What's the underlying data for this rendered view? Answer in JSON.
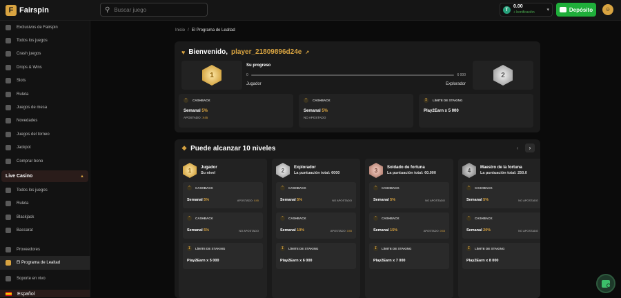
{
  "brand": {
    "name": "Fairspin"
  },
  "search": {
    "placeholder": "Buscar juego"
  },
  "wallet": {
    "amount": "0.00",
    "bonus_label": "+ bonificación",
    "currency_icon": "tether-icon"
  },
  "deposit": {
    "label": "Depósito"
  },
  "sidebar": {
    "items_top": [
      {
        "label": "Exclusivos de Fairspin",
        "icon": "diamond-icon"
      },
      {
        "label": "Todos los juegos",
        "icon": "grid-icon"
      },
      {
        "label": "Crash juegos",
        "icon": "rocket-icon"
      },
      {
        "label": "Drops & Wins",
        "icon": "drop-icon"
      },
      {
        "label": "Slots",
        "icon": "slot-icon"
      },
      {
        "label": "Ruleta",
        "icon": "roulette-icon"
      },
      {
        "label": "Juegos de mesa",
        "icon": "cards-icon"
      },
      {
        "label": "Novedades",
        "icon": "new-icon"
      },
      {
        "label": "Juegos del torneo",
        "icon": "trophy-icon"
      },
      {
        "label": "Jackpot",
        "icon": "jackpot-icon"
      },
      {
        "label": "Comprar bono",
        "icon": "cart-icon"
      }
    ],
    "live_casino_label": "Live Casino",
    "items_live": [
      {
        "label": "Todos los juegos",
        "icon": "grid-icon"
      },
      {
        "label": "Ruleta",
        "icon": "roulette-icon"
      },
      {
        "label": "Blackjack",
        "icon": "blackjack-icon"
      },
      {
        "label": "Baccarat",
        "icon": "baccarat-icon"
      }
    ],
    "items_bottom": [
      {
        "label": "Proveedores",
        "icon": "gamepad-icon"
      },
      {
        "label": "El Programa de Lealtad",
        "icon": "medal-icon"
      },
      {
        "label": "Soporte en vivo",
        "icon": "support-icon"
      }
    ],
    "language": "Español"
  },
  "breadcrumb": {
    "home": "Inicio",
    "separator": "/",
    "current": "El Programa de Lealtad"
  },
  "welcome": {
    "prefix": "Bienvenido,",
    "username": "player_21809896d24e",
    "progress_title": "Su progreso",
    "progress_min": "0",
    "progress_max": "6 000",
    "progress_fraction": 0,
    "current_level": "Jugador",
    "next_level": "Explorador",
    "current_medal": "1",
    "next_medal": "2",
    "benefits": [
      {
        "title": "CASHBACK",
        "line1_label": "Semanal",
        "line1_pct": "5%",
        "line2_label": "APOSTADO:",
        "line2_value": "X45"
      },
      {
        "title": "CASHBACK",
        "line1_label": "Semanal",
        "line1_pct": "5%",
        "line2_label": "NO APOSTADO",
        "line2_value": ""
      },
      {
        "title": "LÍMITE DE STAKING",
        "line1_label": "Play2Earn x 5 000",
        "line1_pct": "",
        "line2_label": "",
        "line2_value": ""
      }
    ]
  },
  "levels": {
    "title": "Puede alcanzar 10 niveles",
    "columns": [
      {
        "medal": "1",
        "name": "Jugador",
        "sub": "Su nivel",
        "cb1": {
          "title": "CASHBACK",
          "label": "Semanal",
          "pct": "5%",
          "note_label": "APOSTADO:",
          "note_value": "X45"
        },
        "cb2": {
          "title": "CASHBACK",
          "label": "Semanal",
          "pct": "5%",
          "note_label": "NO APOSTADO",
          "note_value": ""
        },
        "stake": {
          "title": "LÍMITE DE STAKING",
          "label": "Play2Earn x 5 000"
        }
      },
      {
        "medal": "2",
        "name": "Explorador",
        "sub": "La puntuación total:  6000",
        "cb1": {
          "title": "CASHBACK",
          "label": "Semanal",
          "pct": "5%",
          "note_label": "NO APOSTADO",
          "note_value": ""
        },
        "cb2": {
          "title": "CASHBACK",
          "label": "Semanal",
          "pct": "10%",
          "note_label": "APOSTADO:",
          "note_value": "X45"
        },
        "stake": {
          "title": "LÍMITE DE STAKING",
          "label": "Play2Earn x 6 000"
        }
      },
      {
        "medal": "3",
        "name": "Soldado de fortuna",
        "sub": "La puntuación total:  60.000",
        "cb1": {
          "title": "CASHBACK",
          "label": "Semanal",
          "pct": "5%",
          "note_label": "NO APOSTADO",
          "note_value": ""
        },
        "cb2": {
          "title": "CASHBACK",
          "label": "Semanal",
          "pct": "15%",
          "note_label": "APOSTADO:",
          "note_value": "X45"
        },
        "stake": {
          "title": "LÍMITE DE STAKING",
          "label": "Play2Earn x 7 000"
        }
      },
      {
        "medal": "4",
        "name": "Maestro de la fortuna",
        "sub": "La puntuación total:  250.0",
        "cb1": {
          "title": "CASHBACK",
          "label": "Semanal",
          "pct": "5%",
          "note_label": "NO APOSTADO",
          "note_value": ""
        },
        "cb2": {
          "title": "CASHBACK",
          "label": "Semanal",
          "pct": "20%",
          "note_label": "NO APOSTADO",
          "note_value": ""
        },
        "stake": {
          "title": "LÍMITE DE STAKING",
          "label": "Play2Earn x 8 000"
        }
      }
    ]
  },
  "colors": {
    "accent": "#d9a441",
    "deposit": "#1fae3a",
    "panel": "#1a1a1a",
    "card": "#222222"
  }
}
